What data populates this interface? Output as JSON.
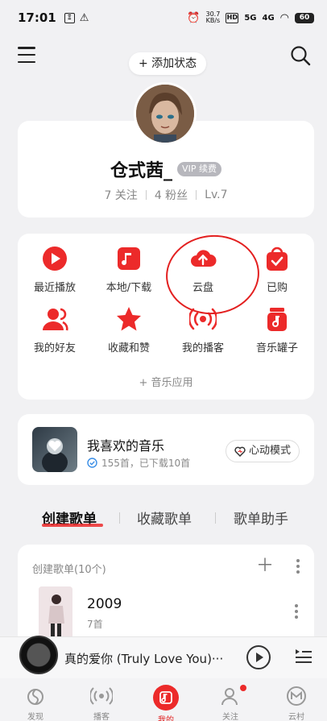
{
  "status_bar": {
    "time": "17:01",
    "speed": "30.7",
    "speed_unit": "KB/s",
    "network": "5G",
    "network2": "4G",
    "battery": "60"
  },
  "header": {
    "add_status": "+ 添加状态"
  },
  "profile": {
    "username": "仓式茜_",
    "vip_label": "VIP 续费",
    "following": "7 关注",
    "followers": "4 粉丝",
    "level": "Lv.7"
  },
  "apps": [
    {
      "label": "最近播放",
      "icon": "recent-play-icon"
    },
    {
      "label": "本地/下载",
      "icon": "local-download-icon"
    },
    {
      "label": "云盘",
      "icon": "cloud-drive-icon"
    },
    {
      "label": "已购",
      "icon": "purchased-icon"
    },
    {
      "label": "我的好友",
      "icon": "friends-icon"
    },
    {
      "label": "收藏和赞",
      "icon": "favorites-icon"
    },
    {
      "label": "我的播客",
      "icon": "podcast-icon"
    },
    {
      "label": "音乐罐子",
      "icon": "music-jar-icon"
    }
  ],
  "music_apps": "+ 音乐应用",
  "liked": {
    "title": "我喜欢的音乐",
    "subtitle": "155首，已下载10首",
    "heart_mode": "心动模式"
  },
  "tabs": [
    "创建歌单",
    "收藏歌单",
    "歌单助手"
  ],
  "playlists": {
    "header": "创建歌单(10个)",
    "items": [
      {
        "title": "2009",
        "count": "7首"
      }
    ]
  },
  "player": {
    "song": "真的爱你 (Truly Love You)···"
  },
  "nav": [
    {
      "label": "发现",
      "icon": "discover-icon"
    },
    {
      "label": "播客",
      "icon": "podcast-nav-icon"
    },
    {
      "label": "我的",
      "icon": "my-music-icon"
    },
    {
      "label": "关注",
      "icon": "follow-icon"
    },
    {
      "label": "云村",
      "icon": "cloud-village-icon"
    }
  ],
  "colors": {
    "accent": "#ec2a2a",
    "background": "#f1f1f3",
    "card": "#ffffff"
  }
}
